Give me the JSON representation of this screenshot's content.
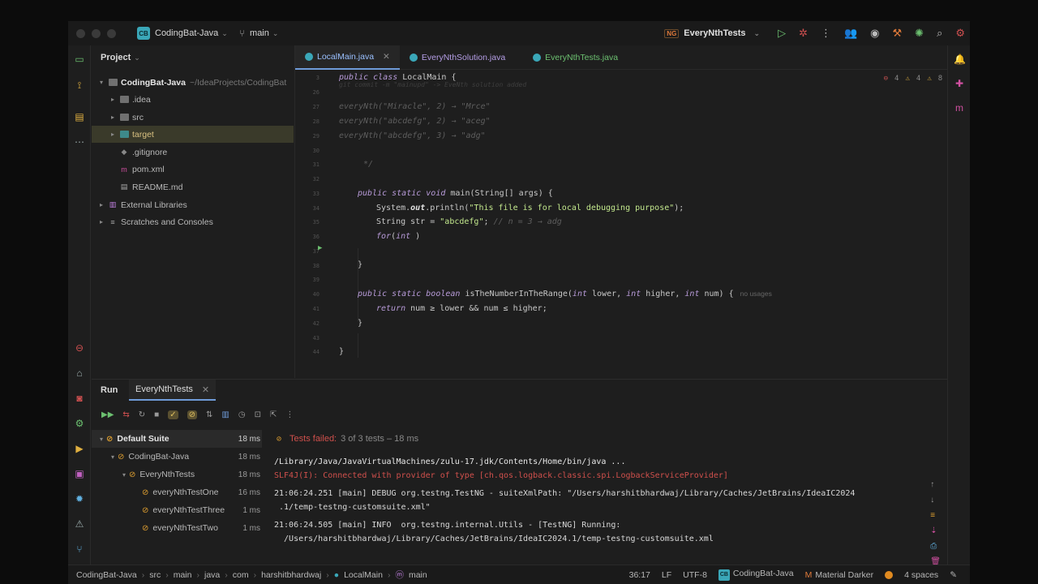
{
  "titlebar": {
    "project_badge": "CB",
    "project_name": "CodingBat-Java",
    "branch": "main",
    "run_config": "EveryNthTests",
    "run_config_badge": "NG"
  },
  "project_panel": {
    "title": "Project",
    "root_name": "CodingBat-Java",
    "root_path": "~/IdeaProjects/CodingBat",
    "items": [
      {
        "label": ".idea"
      },
      {
        "label": "src"
      },
      {
        "label": "target"
      },
      {
        "label": ".gitignore"
      },
      {
        "label": "pom.xml"
      },
      {
        "label": "README.md"
      },
      {
        "label": "External Libraries"
      },
      {
        "label": "Scratches and Consoles"
      }
    ]
  },
  "editor": {
    "tabs": [
      {
        "label": "LocalMain.java"
      },
      {
        "label": "EveryNthSolution.java"
      },
      {
        "label": "EveryNthTests.java"
      }
    ],
    "inspections": {
      "errors": "4",
      "warnings": "4",
      "weak": "8"
    },
    "line_numbers": [
      "3",
      "26",
      "27",
      "28",
      "29",
      "30",
      "31",
      "32",
      "33",
      "34",
      "35",
      "36",
      "37",
      "38",
      "39",
      "40",
      "41",
      "42",
      "43",
      "44"
    ],
    "header_line": "public class LocalMain {",
    "usage_hint": "no usages"
  },
  "run_panel": {
    "title": "Run",
    "tab_label": "EveryNthTests",
    "status_text": "Tests failed:",
    "status_detail": "3 of 3 tests – 18 ms",
    "tree": [
      {
        "label": "Default Suite",
        "time": "18 ms"
      },
      {
        "label": "CodingBat-Java",
        "time": "18 ms"
      },
      {
        "label": "EveryNthTests",
        "time": "18 ms"
      },
      {
        "label": "everyNthTestOne",
        "time": "16 ms"
      },
      {
        "label": "everyNthTestThree",
        "time": "1 ms"
      },
      {
        "label": "everyNthTestTwo",
        "time": "1 ms"
      }
    ],
    "console": [
      "/Library/Java/JavaVirtualMachines/zulu-17.jdk/Contents/Home/bin/java ...",
      "SLF4J(I): Connected with provider of type [ch.qos.logback.classic.spi.LogbackServiceProvider]",
      "21:06:24.251 [main] DEBUG org.testng.TestNG - suiteXmlPath: \"/Users/harshitbhardwaj/Library/Caches/JetBrains/IdeaIC2024",
      " .1/temp-testng-customsuite.xml\"",
      "21:06:24.505 [main] INFO  org.testng.internal.Utils - [TestNG] Running:",
      "  /Users/harshitbhardwaj/Library/Caches/JetBrains/IdeaIC2024.1/temp-testng-customsuite.xml"
    ]
  },
  "statusbar": {
    "breadcrumbs": [
      "CodingBat-Java",
      "src",
      "main",
      "java",
      "com",
      "harshitbhardwaj",
      "LocalMain",
      "main"
    ],
    "position": "36:17",
    "line_sep": "LF",
    "encoding": "UTF-8",
    "project_badge": "CB",
    "project": "CodingBat-Java",
    "theme": "Material Darker",
    "indent": "4 spaces"
  },
  "colors": {
    "accent": "#6f9bd8",
    "keyword": "#b89bd9",
    "string": "#c3e88d",
    "fail": "#d0504c",
    "warning": "#e0a030"
  }
}
